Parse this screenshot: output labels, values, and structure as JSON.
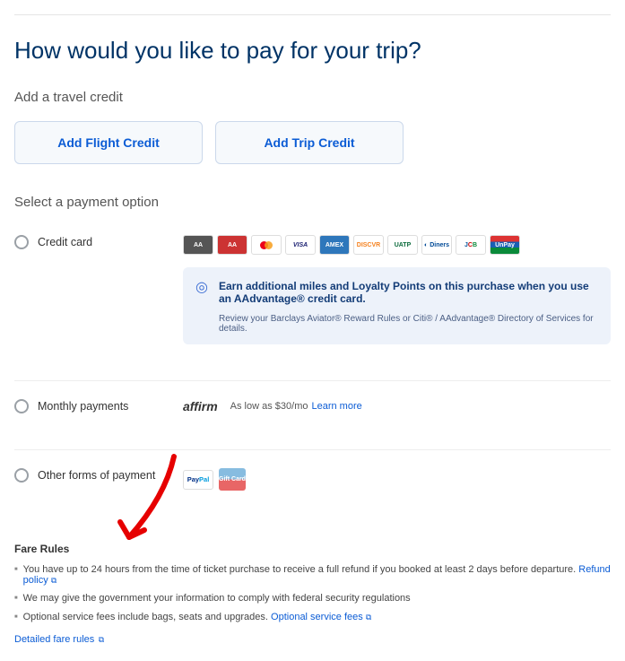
{
  "page_title": "How would you like to pay for your trip?",
  "travel_credit": {
    "section_label": "Add a travel credit",
    "add_flight_credit": "Add Flight Credit",
    "add_trip_credit": "Add Trip Credit"
  },
  "payment": {
    "section_label": "Select a payment option",
    "credit_card_label": "Credit card",
    "card_brands": [
      "aa-black",
      "aa-red",
      "mastercard",
      "visa",
      "amex",
      "discover",
      "uatp",
      "diners",
      "jcb",
      "unionpay"
    ],
    "miles_bold": "Earn additional miles and Loyalty Points on this purchase when you use an AAdvantage® credit card.",
    "miles_sub": "Review your Barclays Aviator® Reward Rules or Citi® / AAdvantage® Directory of Services for details.",
    "monthly_label": "Monthly payments",
    "affirm_logo": "affirm",
    "affirm_text": "As low as $30/mo",
    "affirm_link": "Learn more",
    "other_label": "Other forms of payment",
    "paypal_label": "PayPal",
    "giftcard_label": "Gift Card"
  },
  "fare_rules": {
    "heading": "Fare Rules",
    "rule1": "You have up to 24 hours from the time of ticket purchase to receive a full refund if you booked at least 2 days before departure.",
    "refund_link": "Refund policy",
    "rule2": "We may give the government your information to comply with federal security regulations",
    "rule3": "Optional service fees include bags, seats and upgrades.",
    "service_fees_link": "Optional service fees",
    "detailed_link": "Detailed fare rules"
  }
}
